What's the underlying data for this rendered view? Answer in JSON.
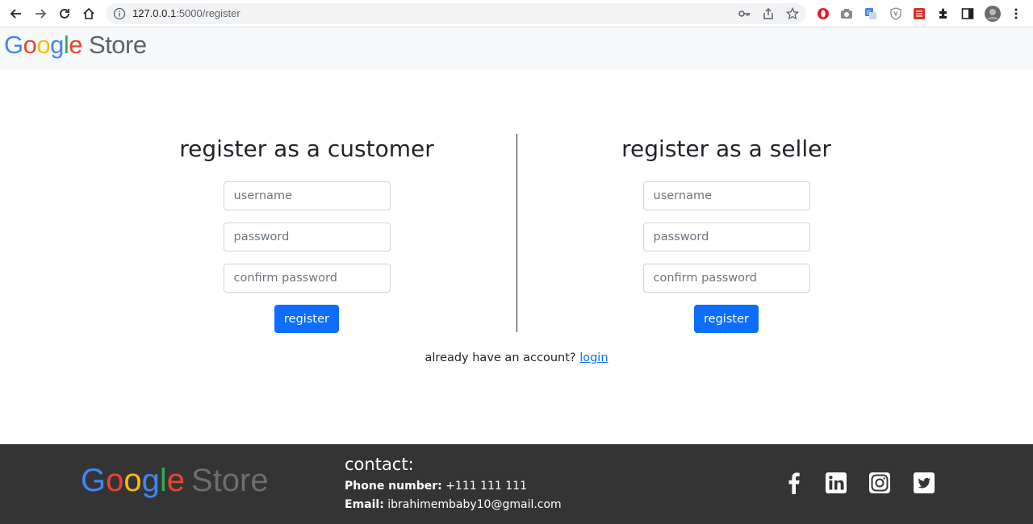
{
  "browser": {
    "url_host": "127.0.0.1",
    "url_path": ":5000/register"
  },
  "header": {
    "logo_letters": [
      "G",
      "o",
      "o",
      "g",
      "l",
      "e"
    ],
    "logo_store": "Store"
  },
  "customer_form": {
    "title": "register as a customer",
    "username_placeholder": "username",
    "password_placeholder": "password",
    "confirm_placeholder": "confirm password",
    "button_label": "register"
  },
  "seller_form": {
    "title": "register as a seller",
    "username_placeholder": "username",
    "password_placeholder": "password",
    "confirm_placeholder": "confirm password",
    "button_label": "register"
  },
  "login_prompt": {
    "text": "already have an account?",
    "link_label": "login"
  },
  "footer": {
    "logo_letters": [
      "G",
      "o",
      "o",
      "g",
      "l",
      "e"
    ],
    "logo_store": "Store",
    "contact_title": "contact:",
    "phone_label": "Phone number:",
    "phone_value": "+111 111 111",
    "email_label": "Email:",
    "email_value": "ibrahimembaby10@gmail.com",
    "social_icons": [
      "facebook-icon",
      "linkedin-icon",
      "instagram-icon",
      "twitter-icon"
    ]
  },
  "colors": {
    "primary": "#0d6efd",
    "footer_bg": "#343434",
    "header_bg": "#f8f9fa"
  }
}
